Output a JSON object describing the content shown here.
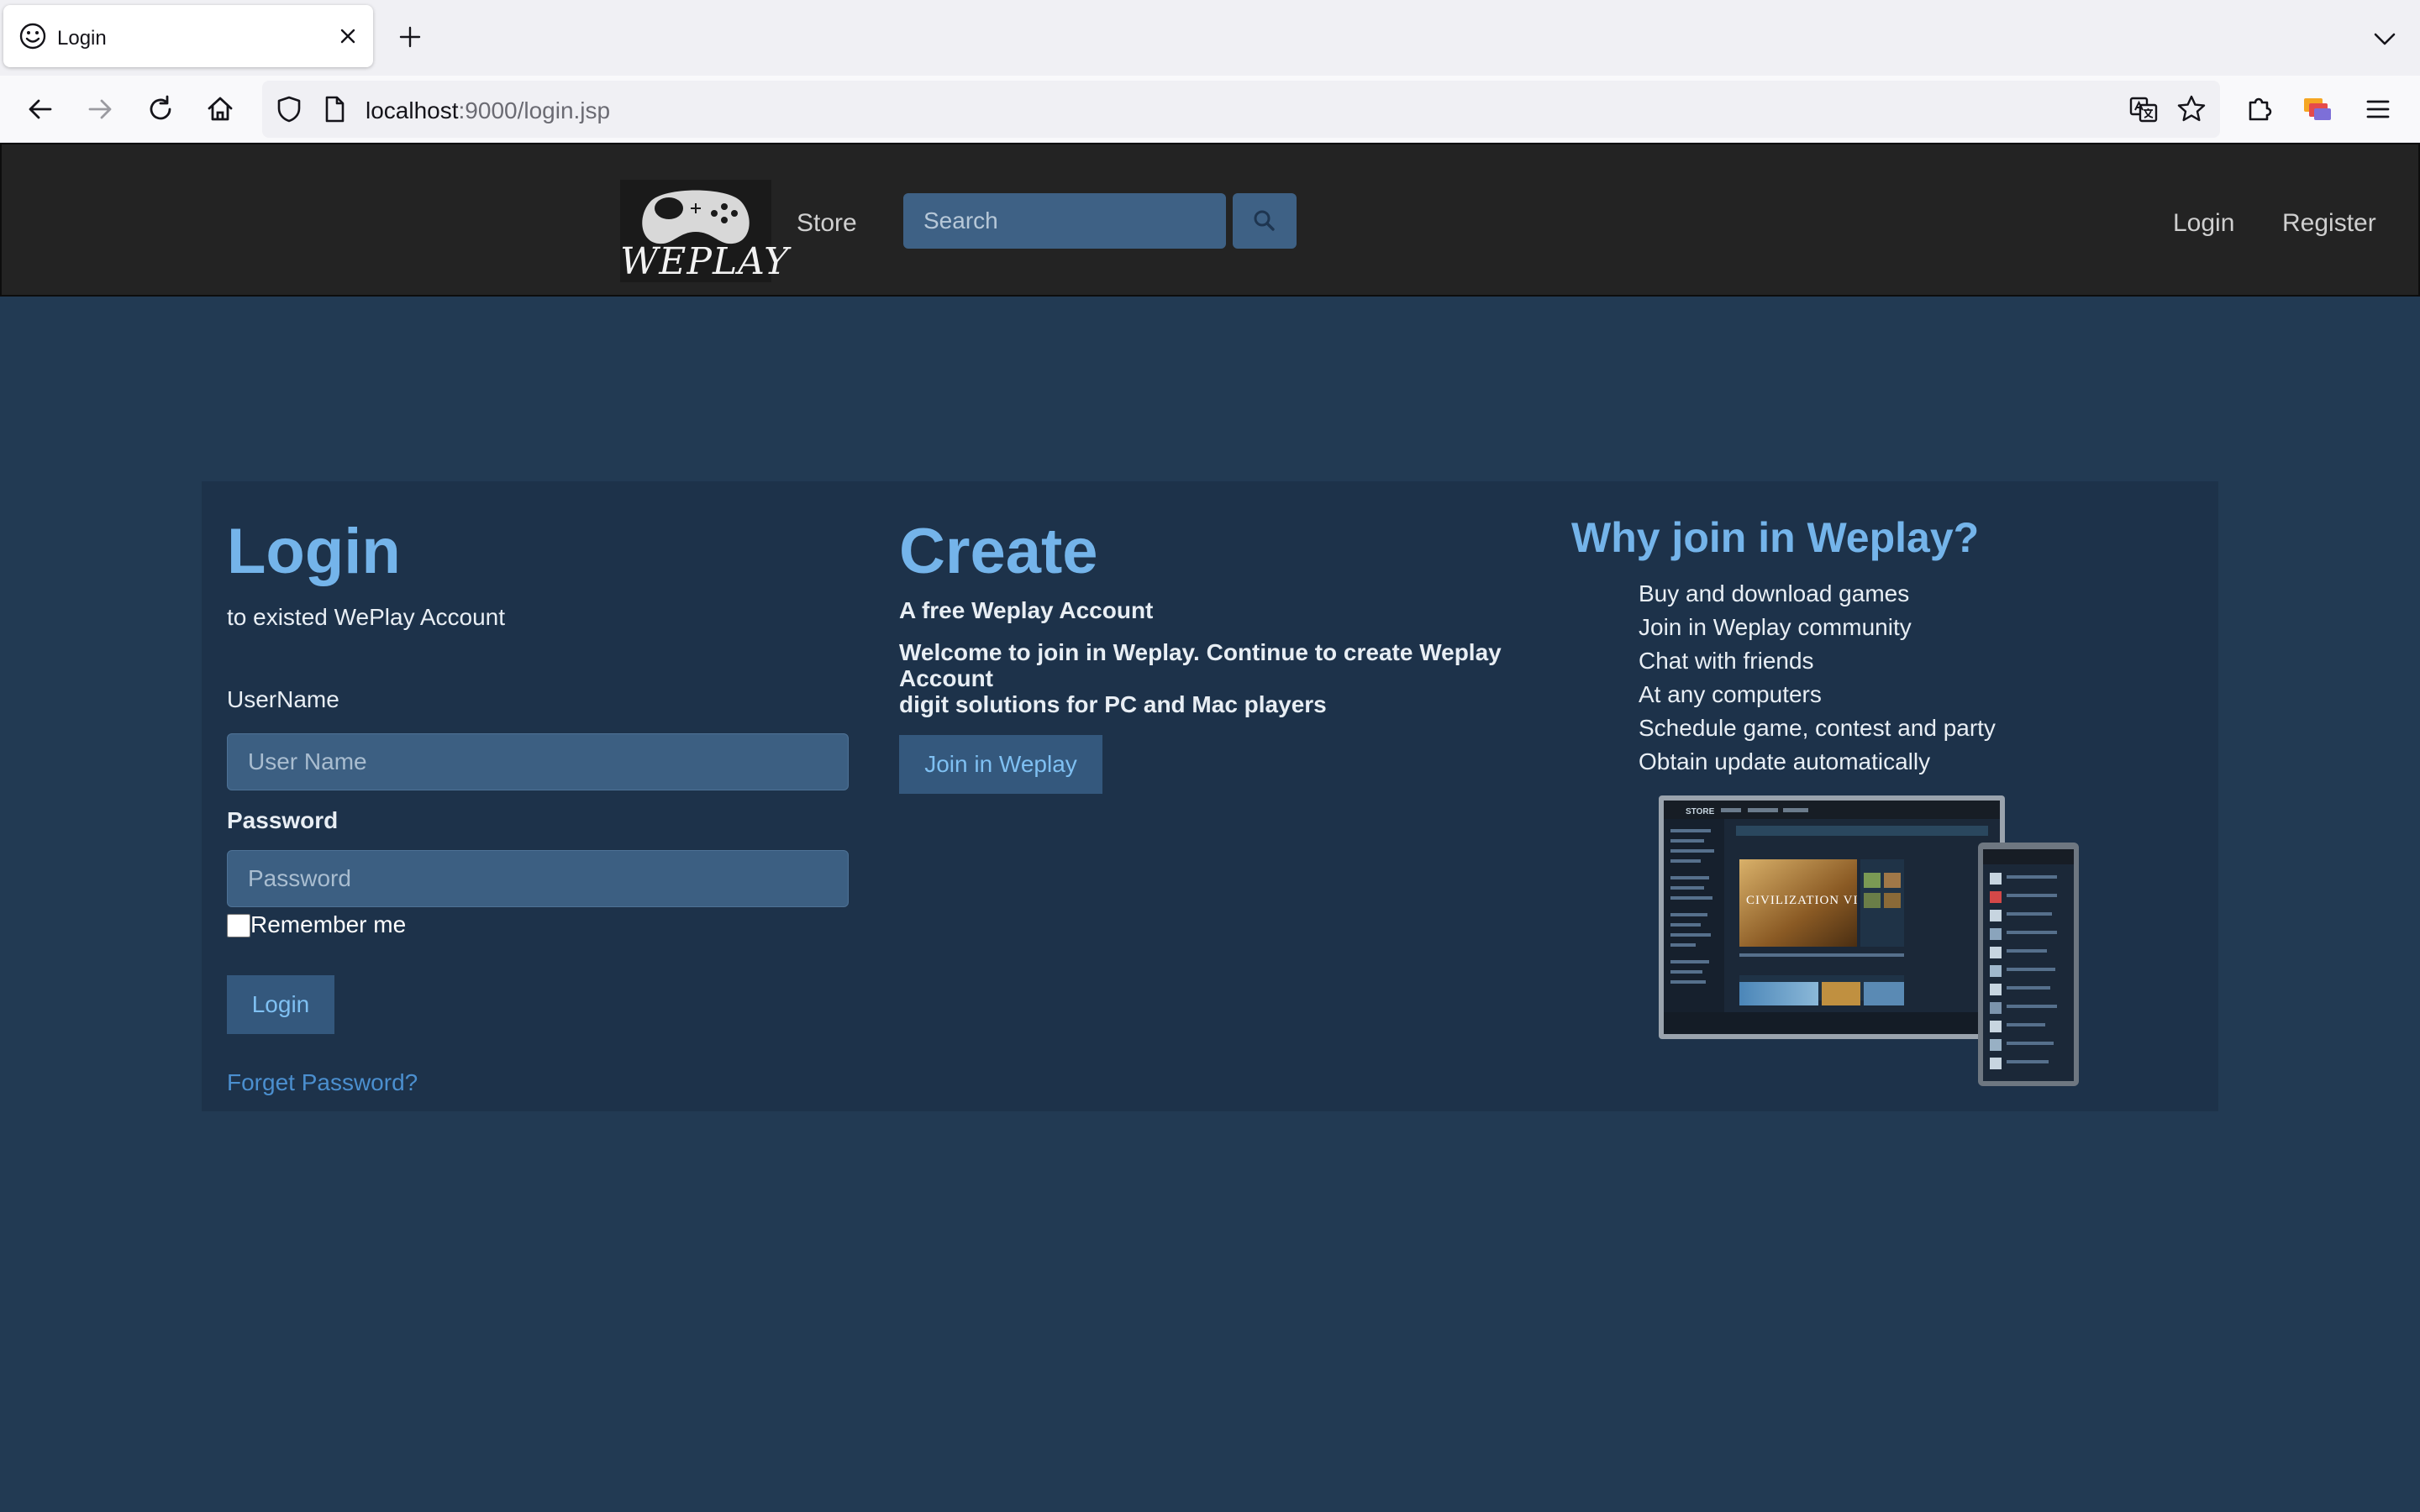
{
  "browser": {
    "tab": {
      "title": "Login"
    },
    "url": {
      "host": "localhost",
      "rest": ":9000/login.jsp"
    }
  },
  "header": {
    "logo_text": "WEPLAY",
    "nav_store": "Store",
    "search_placeholder": "Search",
    "nav_login": "Login",
    "nav_register": "Register"
  },
  "login": {
    "title": "Login",
    "subtitle": "to existed WePlay Account",
    "username_label": "UserName",
    "username_placeholder": "User Name",
    "password_label": "Password",
    "password_placeholder": "Password",
    "remember_label": "Remember me",
    "button": "Login",
    "forget": "Forget Password?"
  },
  "create": {
    "title": "Create",
    "subtitle": "A free Weplay Account",
    "desc_line1": "Welcome to join in Weplay. Continue to create Weplay Account",
    "desc_line2": "digit solutions for PC and Mac players",
    "button": "Join in Weplay"
  },
  "why": {
    "title": "Why join in Weplay?",
    "items": [
      "Buy and download games",
      "Join in Weplay community",
      "Chat with friends",
      "At any computers",
      "Schedule game, contest and party",
      "Obtain update automatically"
    ],
    "screenshot_banner": "CIVILIZATION VI",
    "screenshot_store": "STORE"
  },
  "colors": {
    "page_bg": "#223a53",
    "panel_bg": "#1d324a",
    "header_bg": "#232323",
    "accent": "#74b4ea",
    "link": "#4b8fcf",
    "button_bg": "#34587d"
  }
}
